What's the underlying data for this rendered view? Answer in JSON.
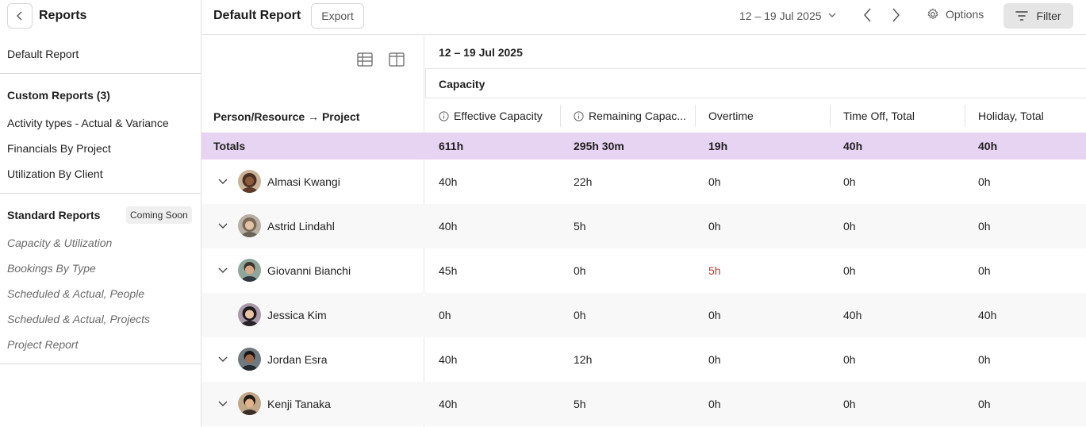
{
  "sidebar": {
    "title": "Reports",
    "default_item": "Default Report",
    "custom_heading": "Custom Reports (3)",
    "custom_items": [
      "Activity types - Actual & Variance",
      "Financials By Project",
      "Utilization By Client"
    ],
    "standard_heading": "Standard Reports",
    "standard_badge": "Coming Soon",
    "standard_items": [
      "Capacity & Utilization",
      "Bookings By Type",
      "Scheduled & Actual, People",
      "Scheduled & Actual, Projects",
      "Project Report"
    ]
  },
  "toolbar": {
    "title": "Default Report",
    "export_label": "Export",
    "date_range": "12 – 19 Jul 2025",
    "options_label": "Options",
    "filter_label": "Filter"
  },
  "table": {
    "period_header": "12 – 19 Jul 2025",
    "group_header": "Capacity",
    "person_column": "Person/Resource → Project",
    "columns": [
      "Effective Capacity",
      "Remaining Capac...",
      "Overtime",
      "Time Off, Total",
      "Holiday, Total"
    ],
    "totals_label": "Totals",
    "totals": [
      "611h",
      "295h 30m",
      "19h",
      "40h",
      "40h"
    ],
    "rows": [
      {
        "name": "Almasi Kwangi",
        "values": [
          "40h",
          "22h",
          "0h",
          "0h",
          "0h"
        ]
      },
      {
        "name": "Astrid Lindahl",
        "values": [
          "40h",
          "5h",
          "0h",
          "0h",
          "0h"
        ]
      },
      {
        "name": "Giovanni Bianchi",
        "values": [
          "45h",
          "0h",
          "5h",
          "0h",
          "0h"
        ]
      },
      {
        "name": "Jessica Kim",
        "values": [
          "0h",
          "0h",
          "0h",
          "40h",
          "40h"
        ]
      },
      {
        "name": "Jordan Esra",
        "values": [
          "40h",
          "12h",
          "0h",
          "0h",
          "0h"
        ]
      },
      {
        "name": "Kenji Tanaka",
        "values": [
          "40h",
          "5h",
          "0h",
          "0h",
          "0h"
        ]
      }
    ]
  },
  "colors": {
    "totals_row": "#e7d3f2",
    "overtime_alert": "#c0392b"
  }
}
